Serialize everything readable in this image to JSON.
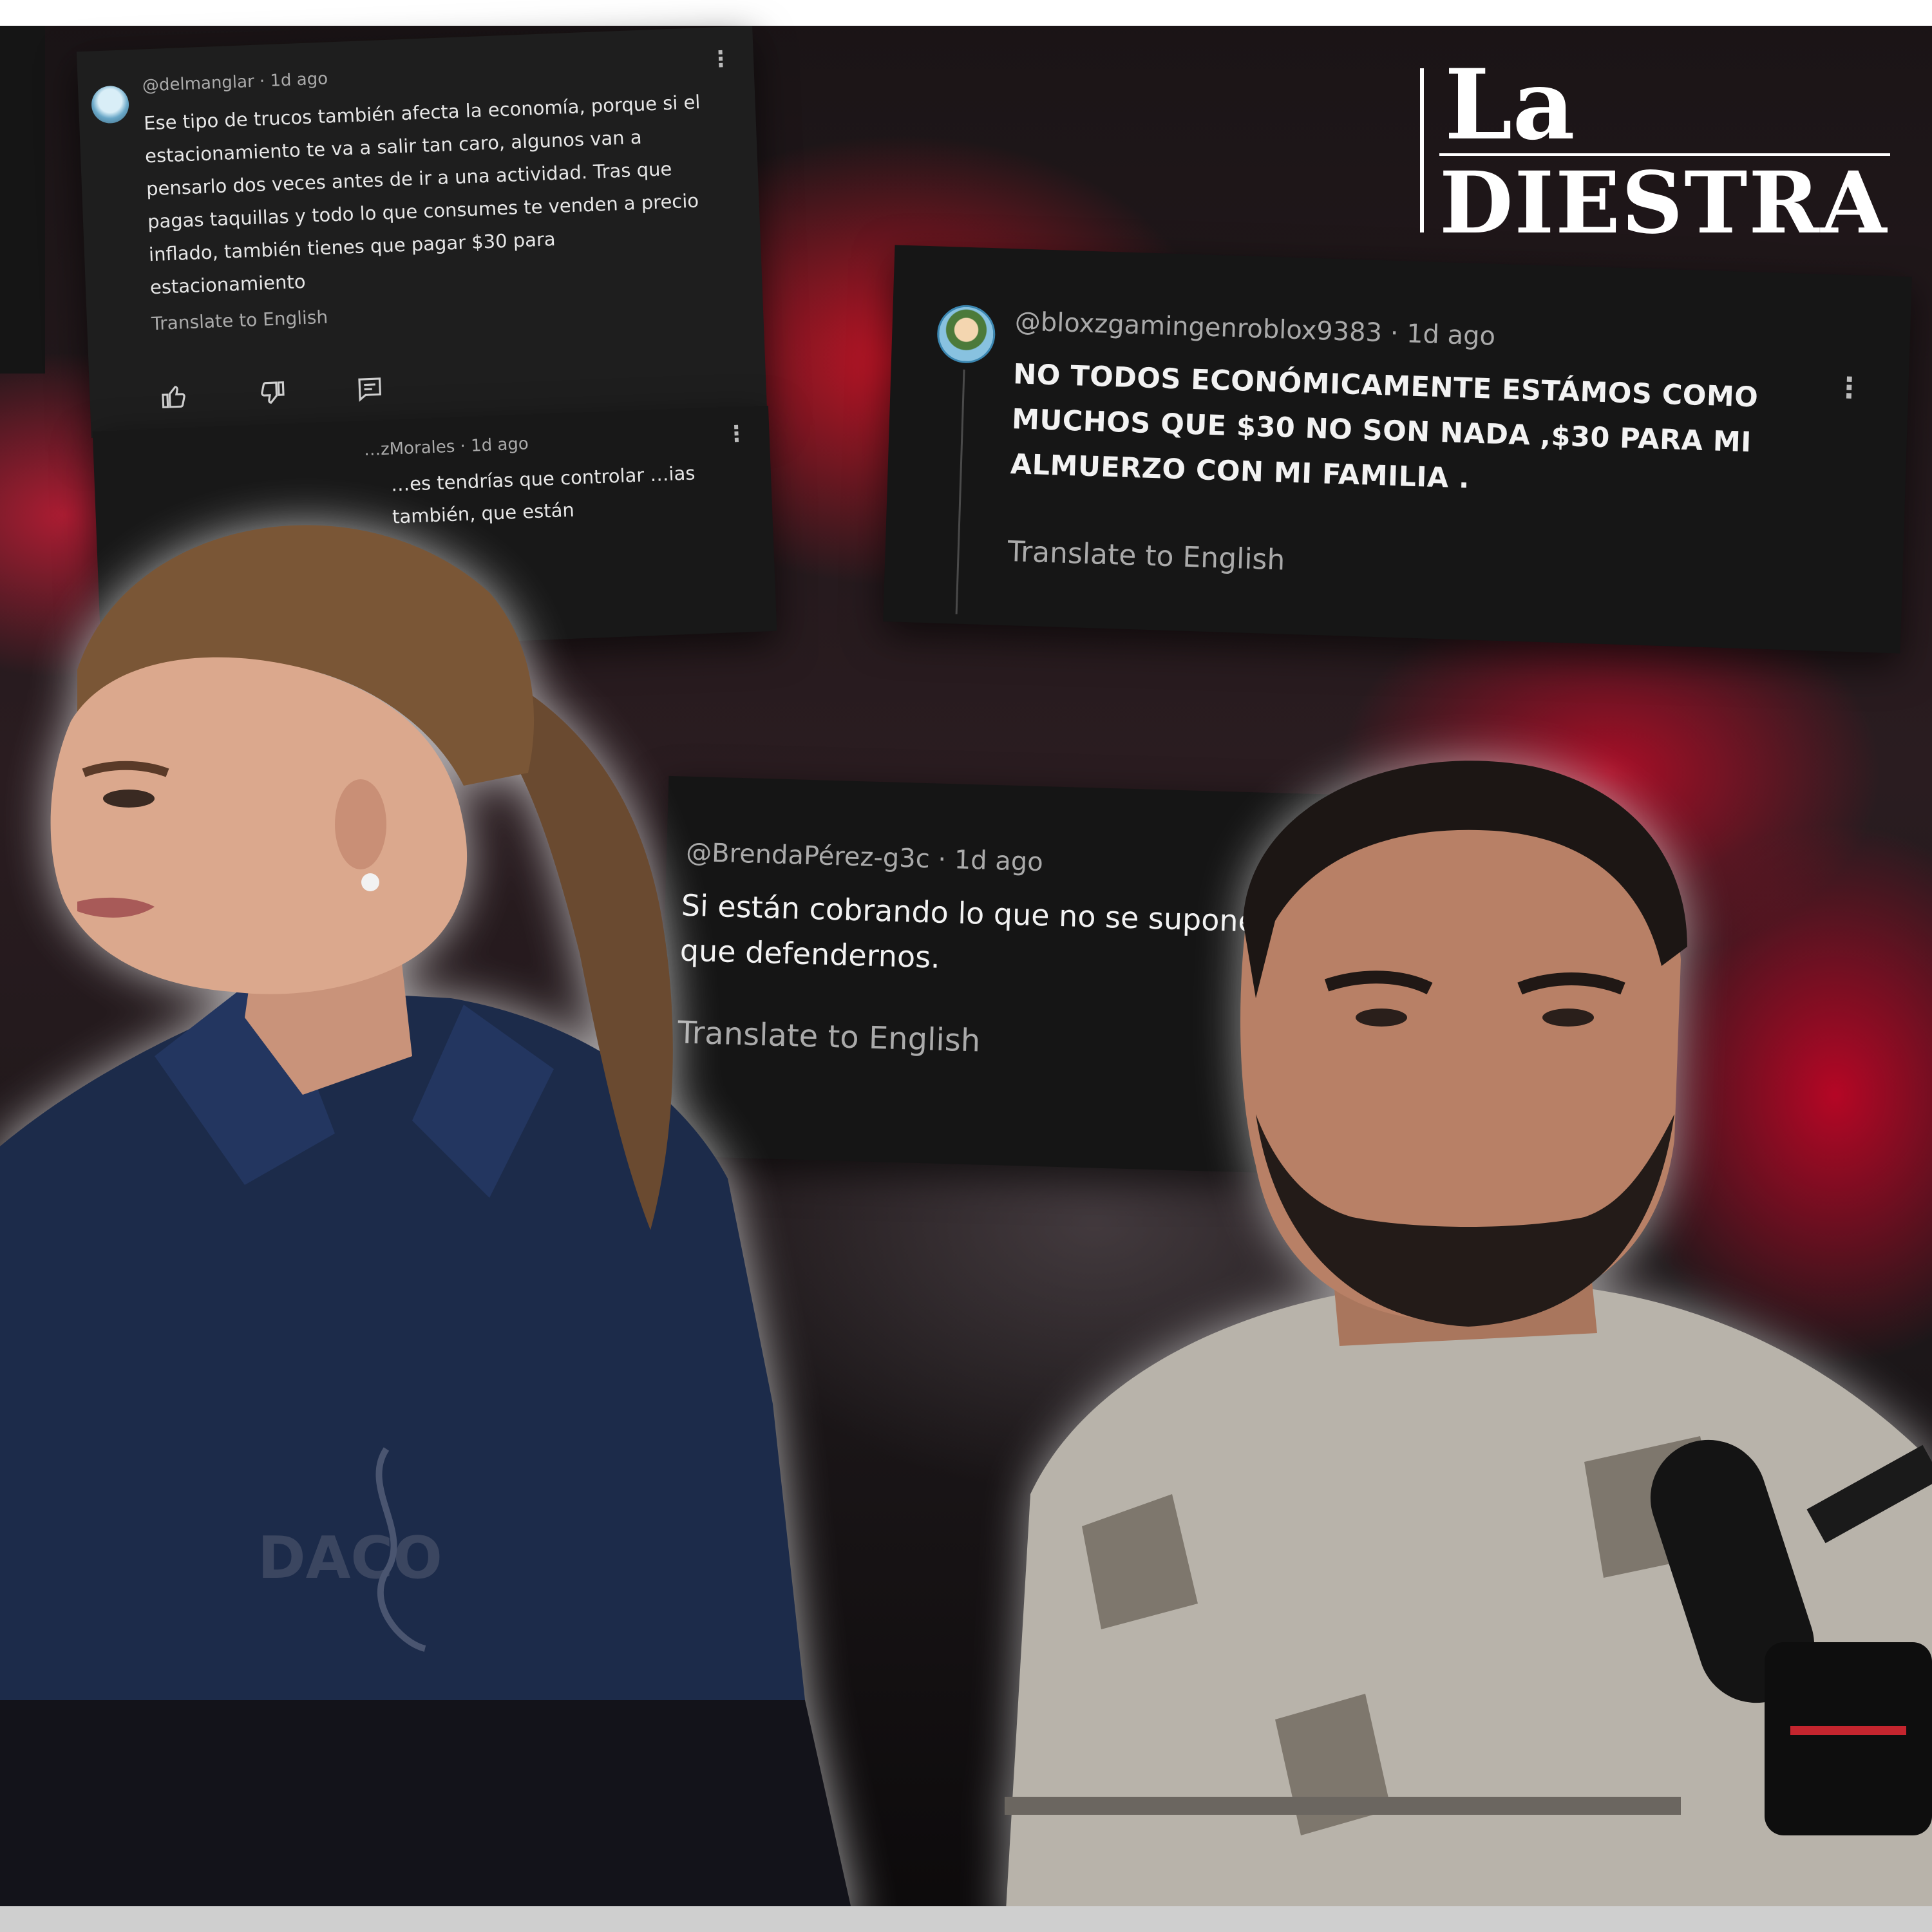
{
  "logo": {
    "line1": "La",
    "line2": "DIESTRA"
  },
  "comments": [
    {
      "handle": "@delmanglar",
      "time": "1d ago",
      "text": "Ese tipo de trucos también afecta la economía, porque si el estacionamiento te va a salir tan caro, algunos van a pensarlo dos veces antes de ir a una actividad. Tras que pagas taquillas y todo lo que consumes te venden a precio inflado, también tienes que pagar $30 para estacionamiento",
      "translate": "Translate to English"
    },
    {
      "handle": "…zMorales",
      "time": "1d ago",
      "text": "…es tendrías que controlar …ias también, que están"
    },
    {
      "handle": "@bloxzgamingenroblox9383",
      "time": "1d ago",
      "text": "NO TODOS ECONÓMICAMENTE ESTÁMOS COMO MUCHOS QUE $30 NO SON NADA ,$30 PARA MI ALMUERZO CON MI FAMILIA .",
      "translate": "Translate to English"
    },
    {
      "handle": "@BrendaPérez-g3c",
      "time": "1d ago",
      "text": "Si están cobrando lo que no se supone , alguien tiene que defendernos.",
      "translate": "Translate to English"
    }
  ],
  "jacket_logo": "DACO",
  "icons": {
    "like": "thumbs-up-icon",
    "dislike": "thumbs-down-icon",
    "reply": "reply-icon",
    "more": "kebab-menu-icon"
  }
}
